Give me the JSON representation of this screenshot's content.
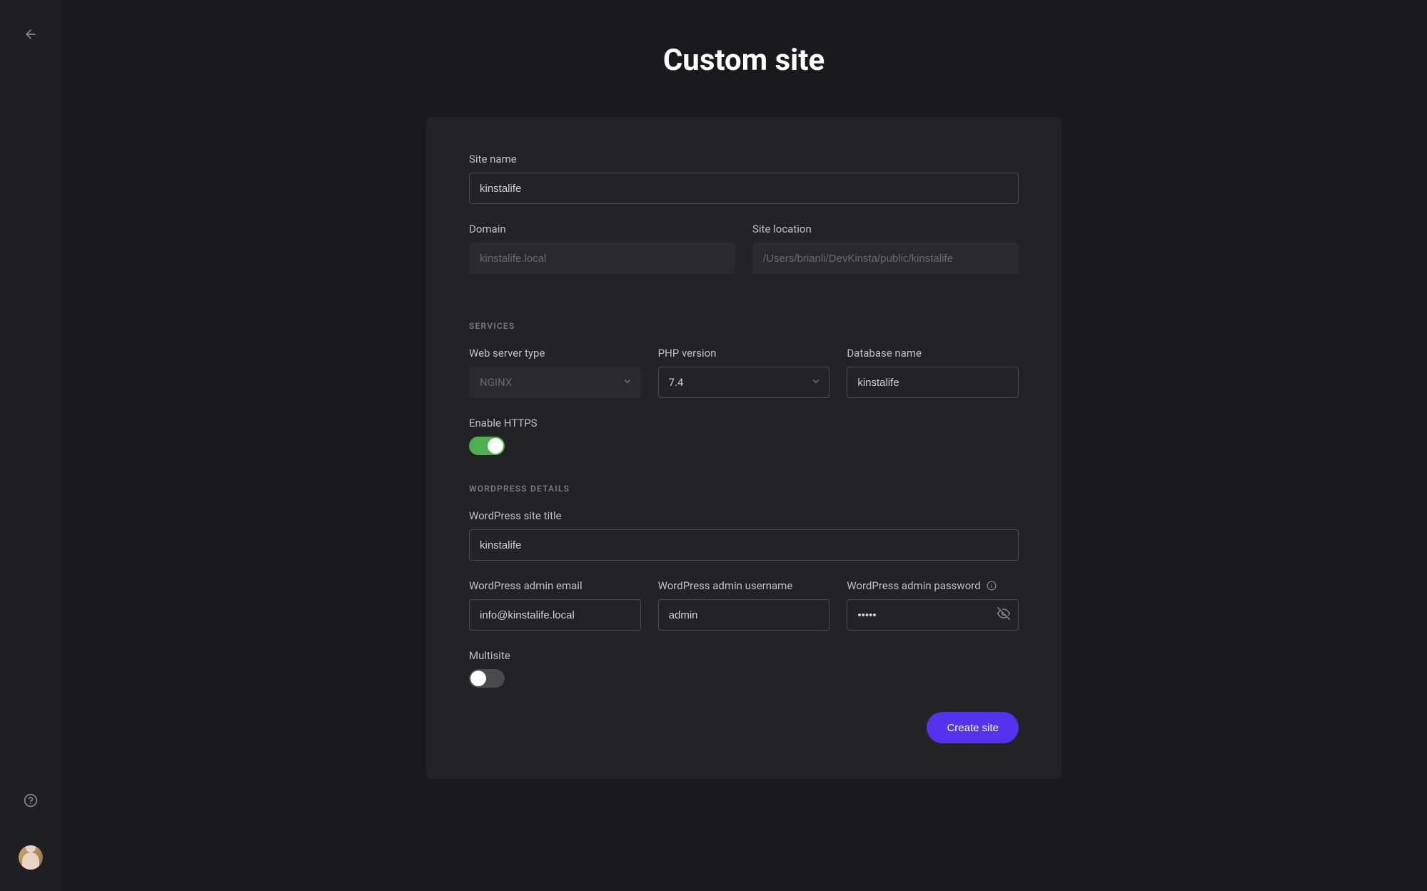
{
  "page": {
    "title": "Custom site"
  },
  "form": {
    "site_name": {
      "label": "Site name",
      "value": "kinstalife"
    },
    "domain": {
      "label": "Domain",
      "value": "kinstalife.local"
    },
    "site_location": {
      "label": "Site location",
      "value": "/Users/brianli/DevKinsta/public/kinstalife"
    },
    "sections": {
      "services": "SERVICES",
      "wordpress": "WORDPRESS DETAILS"
    },
    "web_server_type": {
      "label": "Web server type",
      "value": "NGINX"
    },
    "php_version": {
      "label": "PHP version",
      "value": "7.4"
    },
    "database_name": {
      "label": "Database name",
      "value": "kinstalife"
    },
    "enable_https": {
      "label": "Enable HTTPS",
      "on": true
    },
    "wp_site_title": {
      "label": "WordPress site title",
      "value": "kinstalife"
    },
    "wp_admin_email": {
      "label": "WordPress admin email",
      "value": "info@kinstalife.local"
    },
    "wp_admin_username": {
      "label": "WordPress admin username",
      "value": "admin"
    },
    "wp_admin_password": {
      "label": "WordPress admin password",
      "value": "•••••"
    },
    "multisite": {
      "label": "Multisite",
      "on": false
    },
    "submit_label": "Create site"
  }
}
